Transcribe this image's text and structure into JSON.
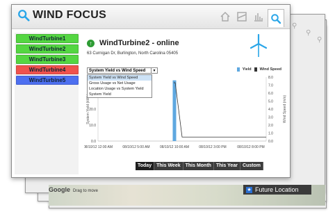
{
  "app": {
    "title": "WIND FOCUS"
  },
  "header": {
    "buttons": [
      {
        "name": "home-icon"
      },
      {
        "name": "map-icon"
      },
      {
        "name": "chart-icon"
      },
      {
        "name": "search-icon"
      }
    ]
  },
  "sidebar": {
    "items": [
      {
        "label": "WindTurbine1",
        "color": "#54d642"
      },
      {
        "label": "WindTurbine2",
        "color": "#54d642"
      },
      {
        "label": "WindTurbine3",
        "color": "#54d642"
      },
      {
        "label": "WindTurbine4",
        "color": "#f0524d"
      },
      {
        "label": "WindTurbine5",
        "color": "#4d6ff0"
      }
    ]
  },
  "turbine": {
    "name": "WindTurbine2 - online",
    "address": "63 Curnigan Dr, Burlington, North Carolina 05405",
    "status_color": "#2e9c34"
  },
  "chart_select": {
    "value": "System Yield vs Wind Speed",
    "options": [
      "System Yield vs Wind Speed",
      "Gross Usage vs Net Usage",
      "Location Usage vs System Yield",
      "System Yield"
    ]
  },
  "legend": {
    "yield": "Yield",
    "wind": "Wind Speed",
    "yield_color": "#5fa8e0",
    "wind_color": "#333333"
  },
  "chart_data": {
    "type": "bar",
    "ylabel": "System Yield (kWh)",
    "y2label": "Wind Speed (m/s)",
    "y_ticks": [
      "0.0",
      "10.0",
      "20.0",
      "30.0"
    ],
    "y2_ticks": [
      "0.0",
      "1.0",
      "2.0",
      "3.0",
      "4.0",
      "5.0",
      "6.0",
      "7.0",
      "8.0"
    ],
    "x_ticks": [
      "08/10/12 12:00 AM",
      "08/10/12 5:00 AM",
      "08/10/12 10:00 AM",
      "08/10/12 3:00 PM",
      "08/10/12 8:00 PM"
    ],
    "ylim": [
      0,
      40
    ],
    "y2lim": [
      0,
      8
    ],
    "x_range_hours": [
      0,
      22
    ],
    "yield_bars": [
      {
        "x": 10,
        "value": 38
      }
    ],
    "wind_line": [
      {
        "x": 9.9,
        "y": 7.3
      },
      {
        "x": 10.1,
        "y": 7.3
      },
      {
        "x": 11,
        "y": 0.5
      },
      {
        "x": 22,
        "y": 0.5
      }
    ]
  },
  "back": {
    "google": "Google",
    "google_tip": "Drag to move",
    "future": "Future Location"
  },
  "tabs": [
    {
      "label": "Today",
      "active": true
    },
    {
      "label": "This Week",
      "active": false
    },
    {
      "label": "This Month",
      "active": false
    },
    {
      "label": "This Year",
      "active": false
    },
    {
      "label": "Custom",
      "active": false
    }
  ]
}
